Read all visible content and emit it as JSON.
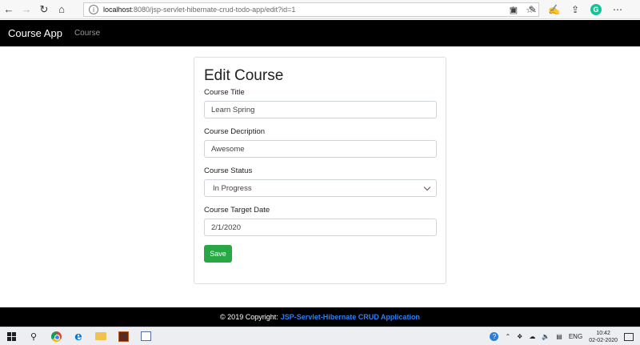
{
  "browser": {
    "url_host": "localhost",
    "url_path": ":8080/jsp-servlet-hibernate-crud-todo-app/edit?id=1"
  },
  "navbar": {
    "brand": "Course App",
    "link": "Course"
  },
  "form": {
    "title": "Edit Course",
    "fields": {
      "title_label": "Course Title",
      "title_value": "Learn Spring",
      "description_label": "Course Decription",
      "description_value": "Awesome",
      "status_label": "Course Status",
      "status_value": "In Progress",
      "date_label": "Course Target Date",
      "date_value": "2/1/2020"
    },
    "save_label": "Save"
  },
  "footer": {
    "text": "© 2019 Copyright:",
    "link": "JSP-Servlet-Hibernate CRUD Application"
  },
  "taskbar": {
    "language": "ENG",
    "time": "10:42",
    "date": "02-02-2020"
  },
  "colors": {
    "navbar": "#000000",
    "save_button": "#28a745",
    "footer_link": "#2d7ff9"
  }
}
